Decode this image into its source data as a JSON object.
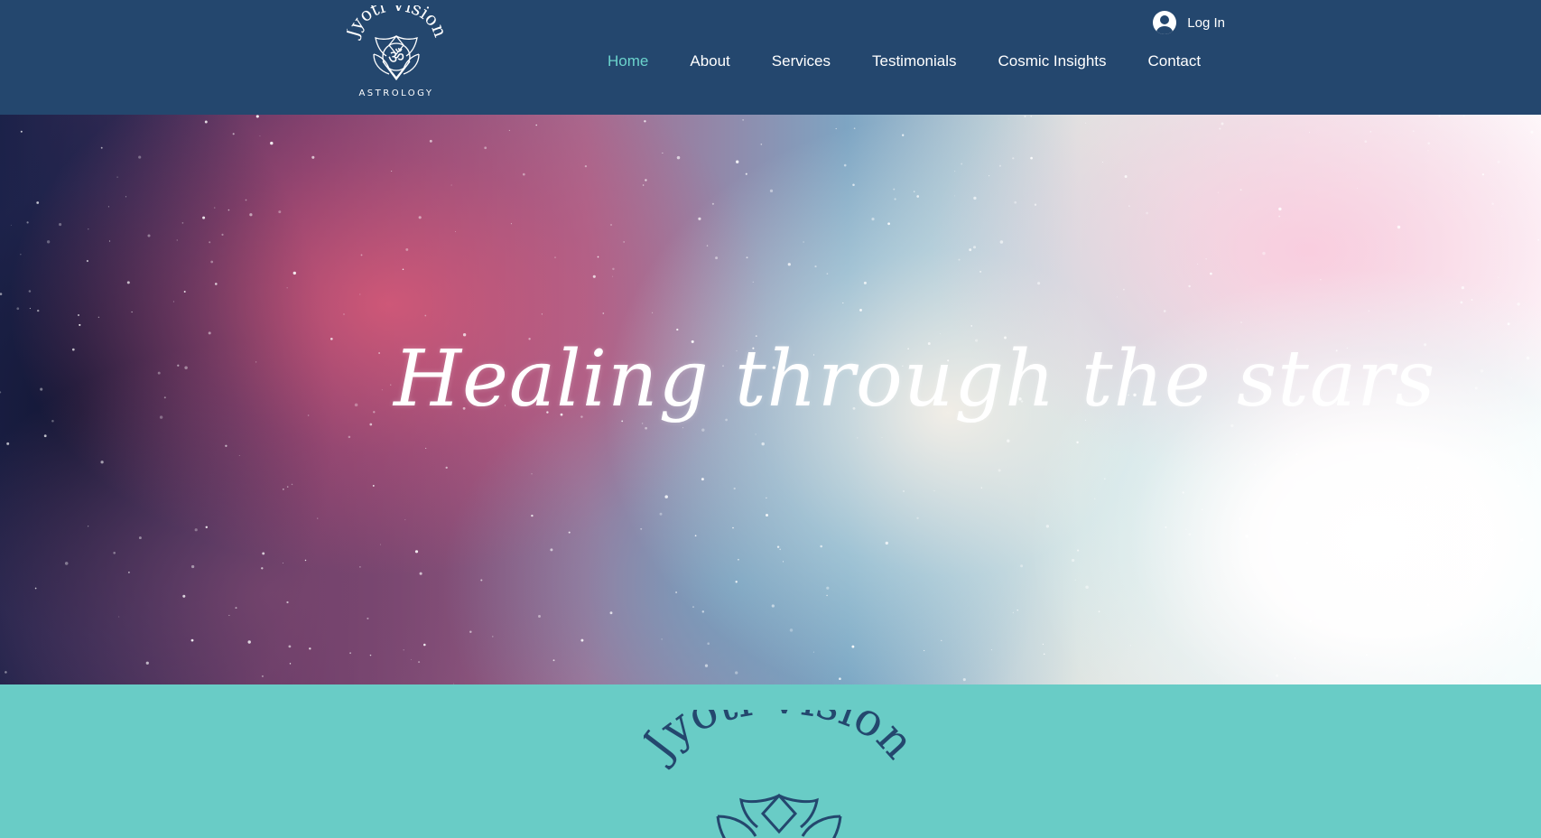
{
  "header": {
    "logo": {
      "brand_text": "Jyoti Vision",
      "subtitle": "ASTROLOGY",
      "icon": "om-lotus-icon"
    },
    "login": {
      "label": "Log In",
      "icon": "user-avatar-icon"
    },
    "nav": [
      {
        "label": "Home",
        "active": true
      },
      {
        "label": "About",
        "active": false
      },
      {
        "label": "Services",
        "active": false
      },
      {
        "label": "Testimonials",
        "active": false
      },
      {
        "label": "Cosmic Insights",
        "active": false
      },
      {
        "label": "Contact",
        "active": false
      }
    ]
  },
  "hero": {
    "title": "Healing through the stars"
  },
  "section": {
    "logo": {
      "brand_text": "Jyoti Vision",
      "icon": "lotus-icon"
    }
  },
  "colors": {
    "header_bg": "#24476e",
    "nav_active": "#6bd3cc",
    "teal_section_bg": "#69ccc6",
    "logo_dark": "#24476e"
  }
}
